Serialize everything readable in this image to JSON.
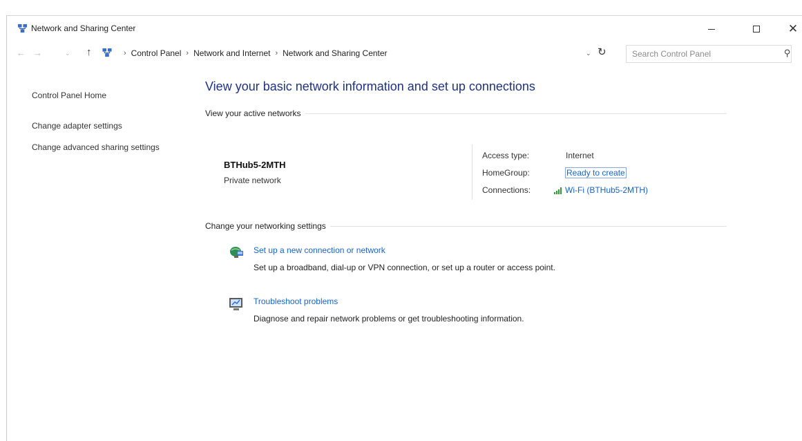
{
  "window": {
    "title": "Network and Sharing Center",
    "title_icon": "network-sharing-center-icon",
    "controls": {
      "minimize": "minimize-icon",
      "maximize": "maximize-icon",
      "close": "close-icon",
      "close_glyph": "✕"
    }
  },
  "address_bar": {
    "breadcrumbs": [
      "Control Panel",
      "Network and Internet",
      "Network and Sharing Center"
    ],
    "separator": "›",
    "search_placeholder": "Search Control Panel"
  },
  "sidebar": {
    "items": [
      {
        "label": "Control Panel Home"
      },
      {
        "label": "Change adapter settings"
      },
      {
        "label": "Change advanced sharing settings"
      }
    ]
  },
  "main": {
    "title": "View your basic network information and set up connections",
    "active_networks": {
      "heading": "View your active networks",
      "network_name": "BTHub5-2MTH",
      "network_type": "Private network",
      "access_type_label": "Access type:",
      "access_type_value": "Internet",
      "homegroup_label": "HomeGroup:",
      "homegroup_value": "Ready to create",
      "connections_label": "Connections:",
      "connections_value": "Wi-Fi (BTHub5-2MTH)"
    },
    "settings": {
      "heading": "Change your networking settings",
      "tasks": [
        {
          "link": "Set up a new connection or network",
          "description": "Set up a broadband, dial-up or VPN connection, or set up a router or access point.",
          "icon": "new-connection-icon"
        },
        {
          "link": "Troubleshoot problems",
          "description": "Diagnose and repair network problems or get troubleshooting information.",
          "icon": "troubleshoot-icon"
        }
      ]
    }
  },
  "colors": {
    "title_blue": "#1e3287",
    "link_blue": "#1763c9",
    "wifi_green": "#2e9a3a"
  }
}
